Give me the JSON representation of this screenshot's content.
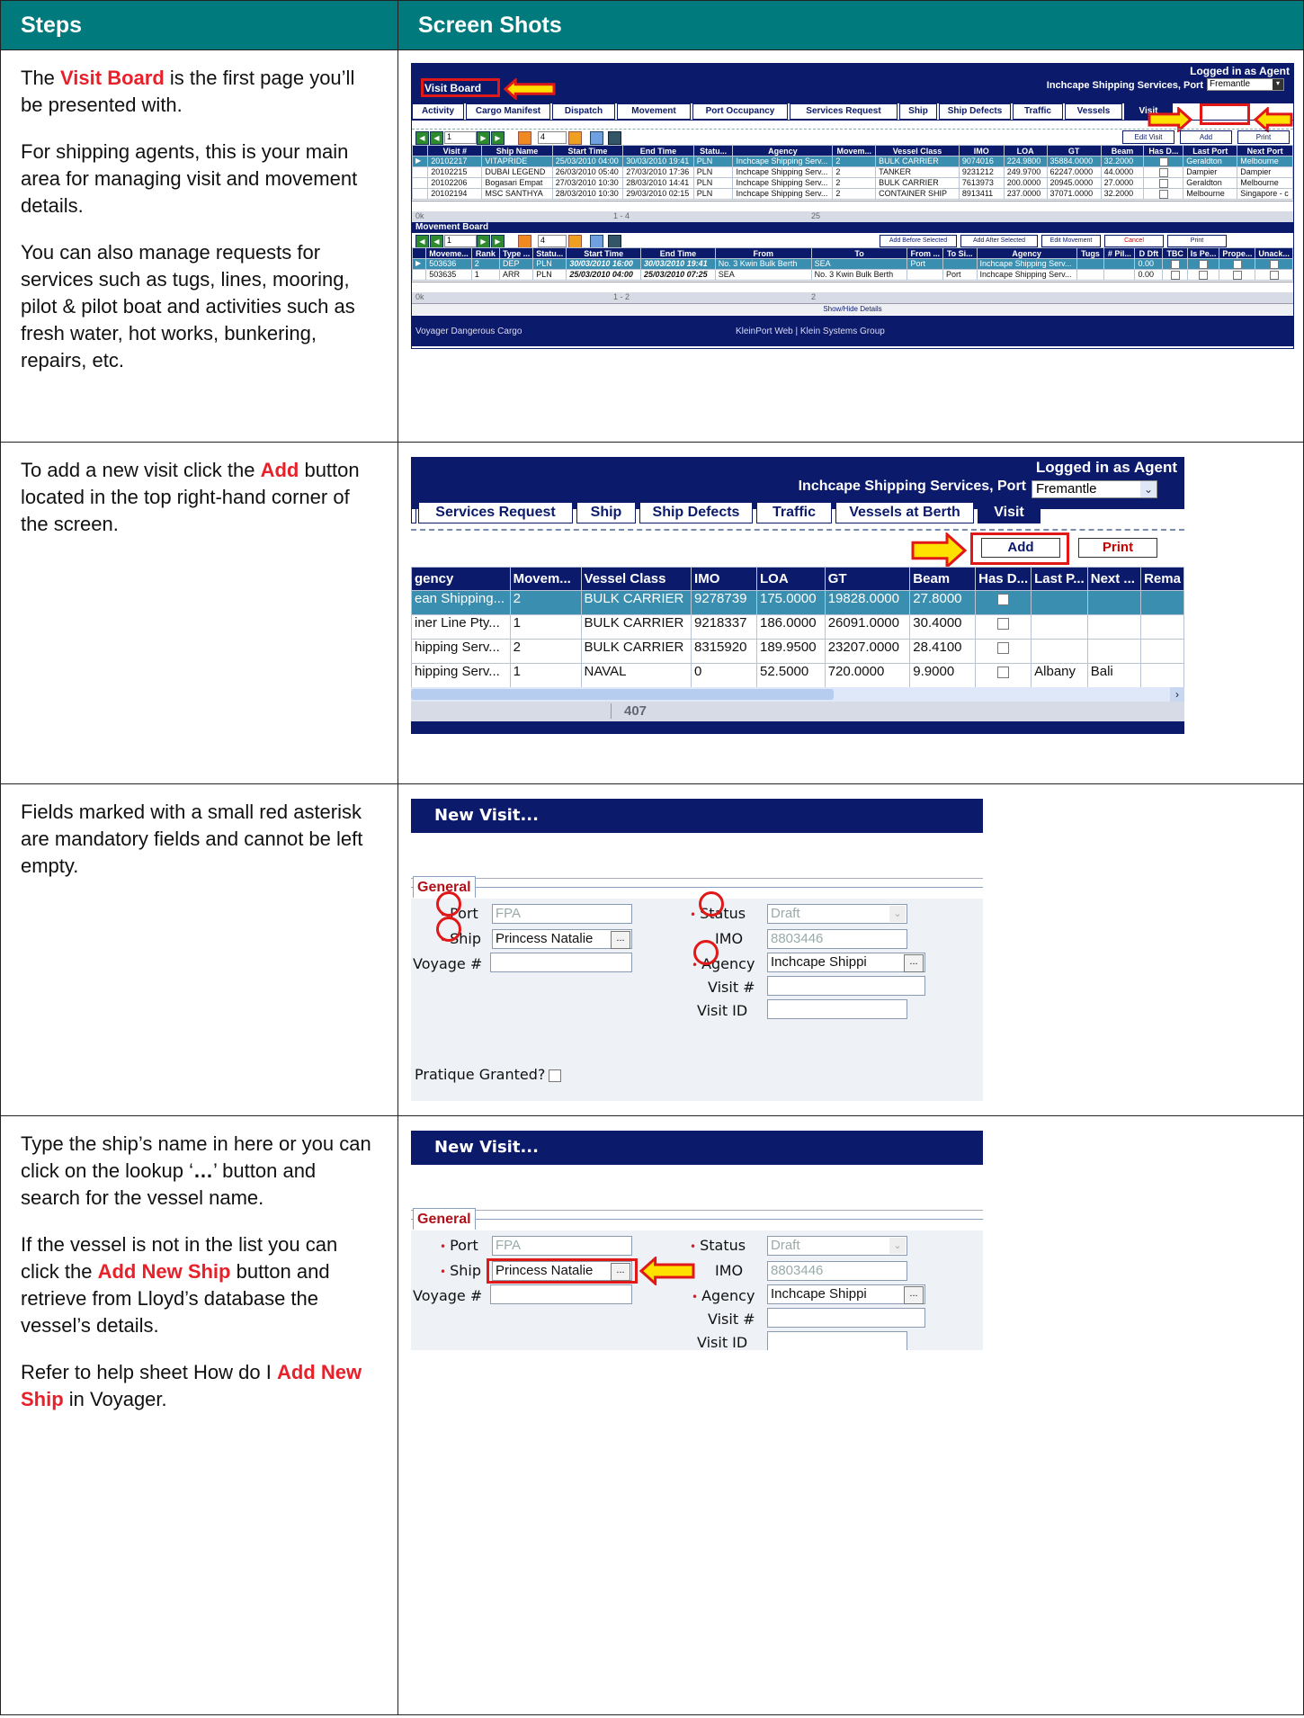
{
  "header": {
    "steps": "Steps",
    "screens": "Screen Shots"
  },
  "rows": [
    {
      "paras": [
        [
          {
            "t": "The "
          },
          {
            "t": "Visit Board",
            "red": true
          },
          {
            "t": " is the first page you’ll be presented with."
          }
        ],
        [
          {
            "t": "For shipping agents, this is your main area for managing visit and movement details."
          }
        ],
        [
          {
            "t": "You can also manage requests for services such as tugs, lines, mooring, pilot & pilot boat and activities such as fresh water, hot works, bunkering, repairs, etc."
          }
        ]
      ]
    },
    {
      "paras": [
        [
          {
            "t": "To add a new visit click the "
          },
          {
            "t": "Add",
            "red": true
          },
          {
            "t": " button located in the top right-hand corner of the screen."
          }
        ]
      ]
    },
    {
      "paras": [
        [
          {
            "t": "Fields marked with a small red asterisk are mandatory fields and cannot be left empty."
          }
        ]
      ]
    },
    {
      "paras": [
        [
          {
            "t": "Type the ship’s name in here or you can click on the lookup ‘"
          },
          {
            "t": "…",
            "bold": true
          },
          {
            "t": "’ button and search for the vessel name."
          }
        ],
        [
          {
            "t": "If the vessel is not in the list you can click the "
          },
          {
            "t": "Add New Ship",
            "red": true
          },
          {
            "t": " button and retrieve from Lloyd’s database the vessel’s details."
          }
        ],
        [
          {
            "t": "Refer to help sheet How do I "
          },
          {
            "t": "Add New Ship",
            "red": true
          },
          {
            "t": " in Voyager."
          }
        ]
      ]
    }
  ],
  "shot1": {
    "logged_in": "Logged in as Agent",
    "company": "Inchcape Shipping Services, Port",
    "port_value": "Fremantle",
    "title": "Visit Board",
    "tabs": [
      "Activity",
      "Cargo Manifest",
      "Dispatch",
      "Movement",
      "Port Occupancy",
      "Services Request",
      "Ship",
      "Ship Defects",
      "Traffic",
      "Vessels",
      "Visit"
    ],
    "page_value": "1",
    "count_value": "4",
    "buttons": [
      "Edit Visit",
      "Add",
      "Print"
    ],
    "columns": [
      "Visit #",
      "Ship Name",
      "Start Time",
      "End Time",
      "Statu...",
      "Agency",
      "Movem...",
      "Vessel Class",
      "IMO",
      "LOA",
      "GT",
      "Beam",
      "Has D...",
      "Last Port",
      "Next Port"
    ],
    "rows": [
      [
        "20102217",
        "VITAPRIDE",
        "25/03/2010 04:00",
        "30/03/2010 19:41",
        "PLN",
        "Inchcape Shipping Serv...",
        "2",
        "BULK CARRIER",
        "9074016",
        "224.9800",
        "35884.0000",
        "32.2000",
        "",
        "Geraldton",
        "Melbourne"
      ],
      [
        "20102215",
        "DUBAI LEGEND",
        "26/03/2010 05:40",
        "27/03/2010 17:36",
        "PLN",
        "Inchcape Shipping Serv...",
        "2",
        "TANKER",
        "9231212",
        "249.9700",
        "62247.0000",
        "44.0000",
        "",
        "Dampier",
        "Dampier"
      ],
      [
        "20102206",
        "Bogasari Empat",
        "27/03/2010 10:30",
        "28/03/2010 14:41",
        "PLN",
        "Inchcape Shipping Serv...",
        "2",
        "BULK CARRIER",
        "7613973",
        "200.0000",
        "20945.0000",
        "27.0000",
        "",
        "Geraldton",
        "Melbourne"
      ],
      [
        "20102194",
        "MSC SANTHYA",
        "28/03/2010 10:30",
        "29/03/2010 02:15",
        "PLN",
        "Inchcape Shipping Serv...",
        "2",
        "CONTAINER SHIP",
        "8913411",
        "237.0000",
        "37071.0000",
        "32.2000",
        "",
        "Melbourne",
        "Singapore - c"
      ]
    ],
    "status": [
      "0k",
      "1 - 4",
      "25"
    ],
    "movement_title": "Movement Board",
    "mv_count": "4",
    "mv_buttons": [
      "Add Before Selected",
      "Add After Selected",
      "Edit Movement",
      "Cancel",
      "Print"
    ],
    "mv_columns": [
      "Moveme...",
      "Rank",
      "Type ...",
      "Statu...",
      "Start Time",
      "End Time",
      "From",
      "To",
      "From ...",
      "To Si...",
      "Agency",
      "Tugs",
      "# Pil...",
      "D Dft",
      "TBC",
      "Is Pe...",
      "Prope...",
      "Unack..."
    ],
    "mv_rows": [
      [
        "503636",
        "2",
        "DEP",
        "PLN",
        "30/03/2010 16:00",
        "30/03/2010 19:41",
        "No. 3 Kwin Bulk Berth",
        "SEA",
        "Port",
        "",
        "Inchcape Shipping Serv...",
        "",
        "",
        "0.00",
        "",
        "",
        "",
        ""
      ],
      [
        "503635",
        "1",
        "ARR",
        "PLN",
        "25/03/2010 04:00",
        "25/03/2010 07:25",
        "SEA",
        "No. 3 Kwin Bulk Berth",
        "",
        "Port",
        "Inchcape Shipping Serv...",
        "",
        "",
        "0.00",
        "",
        "",
        "",
        ""
      ]
    ],
    "mv_status": [
      "0k",
      "1 - 2",
      "2"
    ],
    "show_hide": "Show/Hide Details",
    "footer_left": "Voyager Dangerous Cargo",
    "footer_mid": "KleinPort Web | Klein Systems Group"
  },
  "shot2": {
    "logged_in": "Logged in as Agent",
    "company": "Inchcape Shipping Services, Port",
    "port_value": "Fremantle",
    "tabs": [
      "Services Request",
      "Ship",
      "Ship Defects",
      "Traffic",
      "Vessels at Berth",
      "Visit"
    ],
    "add": "Add",
    "print": "Print",
    "columns": [
      "gency",
      "Movem...",
      "Vessel Class",
      "IMO",
      "LOA",
      "GT",
      "Beam",
      "Has D...",
      "Last P...",
      "Next ...",
      "Rema"
    ],
    "rows": [
      [
        "ean Shipping...",
        "2",
        "BULK CARRIER",
        "9278739",
        "175.0000",
        "19828.0000",
        "27.8000",
        "",
        "",
        "",
        ""
      ],
      [
        "iner Line Pty...",
        "1",
        "BULK CARRIER",
        "9218337",
        "186.0000",
        "26091.0000",
        "30.4000",
        "",
        "",
        "",
        ""
      ],
      [
        "hipping Serv...",
        "2",
        "BULK CARRIER",
        "8315920",
        "189.9500",
        "23207.0000",
        "28.4100",
        "",
        "",
        "",
        ""
      ],
      [
        "hipping Serv...",
        "1",
        "NAVAL",
        "0",
        "52.5000",
        "720.0000",
        "9.9000",
        "",
        "Albany",
        "Bali",
        ""
      ]
    ],
    "status": "407"
  },
  "shot3": {
    "title": "New Visit...",
    "tab": "General",
    "port_label": "Port",
    "port_value": "FPA",
    "ship_label": "Ship",
    "ship_value": "Princess Natalie",
    "voyage_label": "Voyage #",
    "status_label": "Status",
    "status_value": "Draft",
    "imo_label": "IMO",
    "imo_value": "8803446",
    "agency_label": "Agency",
    "agency_value": "Inchcape Shippi",
    "visit_label": "Visit #",
    "visitid_label": "Visit ID",
    "pratique": "Pratique Granted?"
  },
  "shot4": {
    "title": "New Visit...",
    "tab": "General",
    "port_label": "Port",
    "port_value": "FPA",
    "ship_label": "Ship",
    "ship_value": "Princess Natalie",
    "voyage_label": "Voyage #",
    "status_label": "Status",
    "status_value": "Draft",
    "imo_label": "IMO",
    "imo_value": "8803446",
    "agency_label": "Agency",
    "agency_value": "Inchcape Shippi",
    "visit_label": "Visit #",
    "visitid_label": "Visit ID"
  },
  "colors": {
    "header": "#007a7c",
    "accent_red": "#e8202a",
    "app_navy": "#0b1a6b",
    "selected_row": "#3a8fb0"
  }
}
